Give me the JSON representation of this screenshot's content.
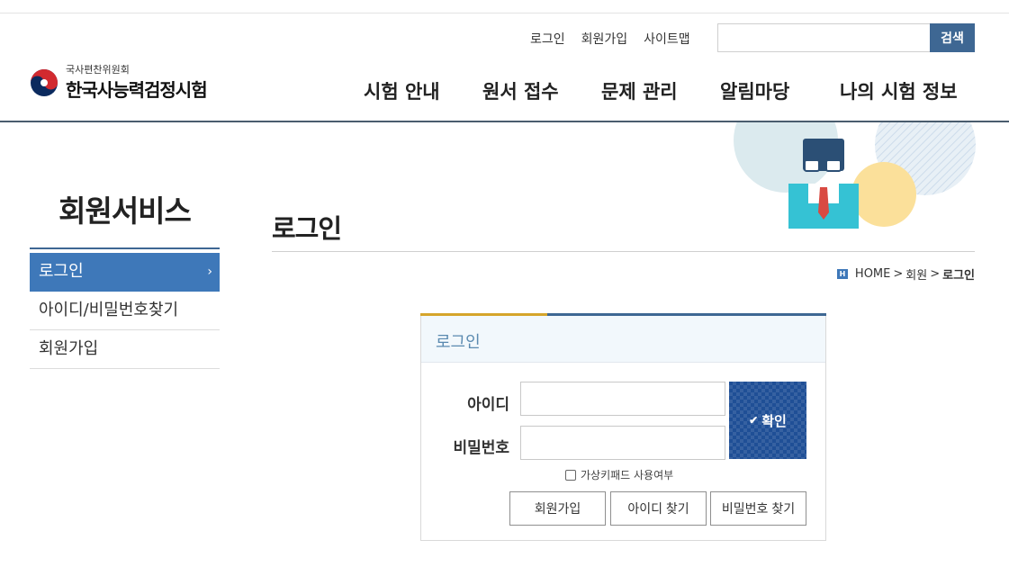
{
  "header": {
    "util_links": [
      "로그인",
      "회원가입",
      "사이트맵"
    ],
    "search": {
      "value": "",
      "button_label": "검색"
    },
    "logo": {
      "sub": "국사편찬위원회",
      "main": "한국사능력검정시험"
    },
    "nav": [
      "시험 안내",
      "원서 접수",
      "문제 관리",
      "알림마당",
      "나의 시험 정보"
    ]
  },
  "sidebar": {
    "title": "회원서비스",
    "items": [
      {
        "label": "로그인",
        "active": true
      },
      {
        "label": "아이디/비밀번호찾기",
        "active": false
      },
      {
        "label": "회원가입",
        "active": false
      }
    ]
  },
  "content": {
    "title": "로그인",
    "breadcrumb": [
      "HOME",
      "회원",
      "로그인"
    ]
  },
  "login": {
    "heading": "로그인",
    "id_label": "아이디",
    "id_value": "",
    "pw_label": "비밀번호",
    "pw_value": "",
    "confirm_label": "확인",
    "virtual_keypad_label": "가상키패드 사용여부",
    "buttons": [
      "회원가입",
      "아이디 찾기",
      "비밀번호 찾기"
    ]
  },
  "colors": {
    "primary": "#3e6793",
    "active": "#3e78b9",
    "accent_gold": "#d5a52b",
    "confirm": "#1f4f96"
  },
  "icons": [
    "government-emblem-icon",
    "home-icon",
    "chevron-right-icon",
    "check-icon",
    "checkbox-icon"
  ]
}
